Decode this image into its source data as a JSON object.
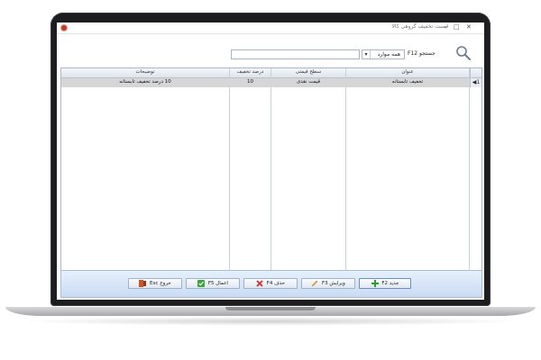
{
  "window": {
    "title": "لیست تخفیف گروهی کالا",
    "controls": {
      "close": "✕",
      "maximize": "□",
      "minimize": "−"
    }
  },
  "search": {
    "label": "جستجو F12",
    "filter_value": "همه موارد",
    "placeholder": ""
  },
  "grid": {
    "columns": [
      "عنوان",
      "سطح قیمتی",
      "درصد تخفیف",
      "توضیحات"
    ],
    "rows": [
      {
        "indicator": "◀1",
        "title": "تخفیف تابستانه",
        "price_level": "قیمت نقدی",
        "discount_percent": "10",
        "description": "10 درصد تخفیف تابستانه"
      }
    ]
  },
  "buttons": {
    "new": "جدید F2",
    "edit": "ویرایش F3",
    "delete": "حذف F4",
    "apply": "اعمال F5",
    "exit": "خروج Esc"
  },
  "colors": {
    "footer": "#c9dbf3",
    "selected_row": "#d6d6d6",
    "new_icon": "#2e9e2e",
    "delete_icon": "#d42b2b",
    "apply_icon": "#3aa53a",
    "exit_icon": "#c8552b"
  },
  "icons": [
    "app-logo",
    "search-icon",
    "plus-icon",
    "pencil-icon",
    "x-icon",
    "check-icon",
    "exit-icon"
  ]
}
